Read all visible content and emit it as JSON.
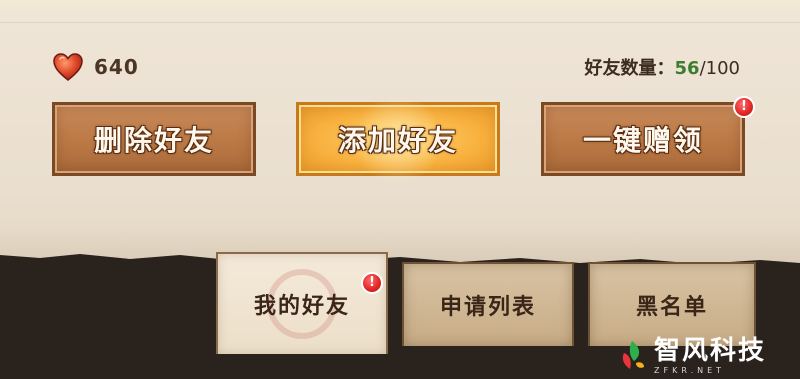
{
  "status": {
    "hp_value": "640",
    "friend_count_label": "好友数量：",
    "friend_count_current": "56",
    "friend_count_separator": "/",
    "friend_count_max": "100"
  },
  "actions": {
    "delete_label": "删除好友",
    "add_label": "添加好友",
    "gift_label": "一键赠领",
    "gift_badge": "!"
  },
  "tabs": [
    {
      "label": "我的好友",
      "active": true,
      "badge": "!"
    },
    {
      "label": "申请列表",
      "active": false
    },
    {
      "label": "黑名单",
      "active": false
    }
  ],
  "watermark": {
    "text": "智风科技",
    "sub": "ZFKR.NET"
  },
  "colors": {
    "accent_orange": "#f8b03e",
    "button_brown": "#b97743",
    "count_green": "#3f7d2e",
    "badge_red": "#e02424"
  },
  "icons": {
    "hp": "heart-icon",
    "badge": "exclamation-badge-icon",
    "logo": "leaf-logo-icon"
  }
}
